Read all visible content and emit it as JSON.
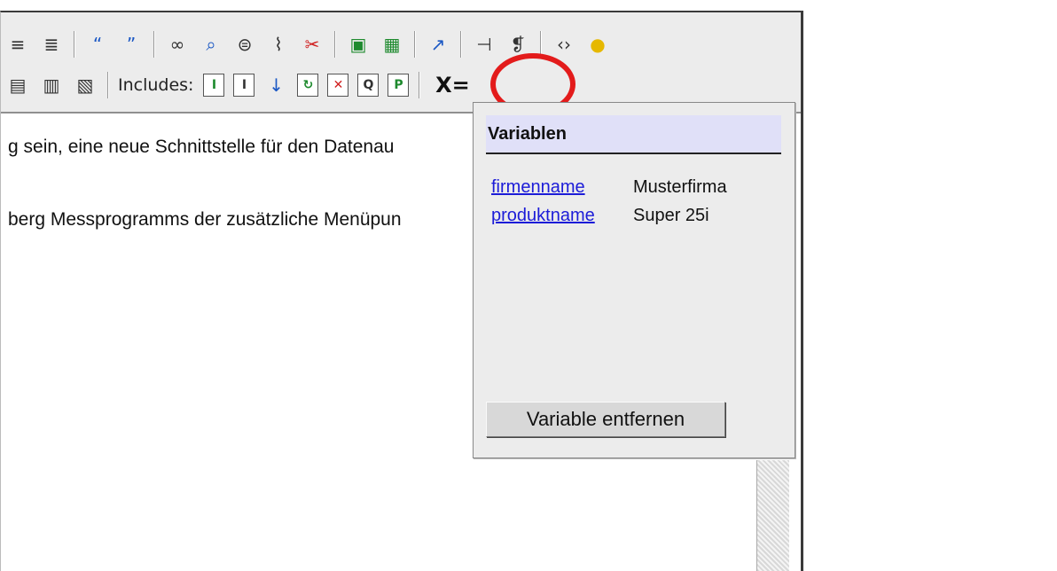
{
  "toolbar": {
    "includes_label": "Includes:",
    "variables_button": "X="
  },
  "content": {
    "line1": "g sein, eine neue Schnittstelle für den Datenau",
    "line2": "berg Messprogramms der zusätzliche Menüpun"
  },
  "popup": {
    "title": "Variablen",
    "variables": [
      {
        "name": "firmenname",
        "value": "Musterfirma"
      },
      {
        "name": "produktname",
        "value": "Super 25i"
      }
    ],
    "remove_button": "Variable entfernen"
  },
  "colors": {
    "highlight_ring": "#e31b1b",
    "link": "#1c1cd8",
    "header_bg": "#e0e0f8"
  }
}
